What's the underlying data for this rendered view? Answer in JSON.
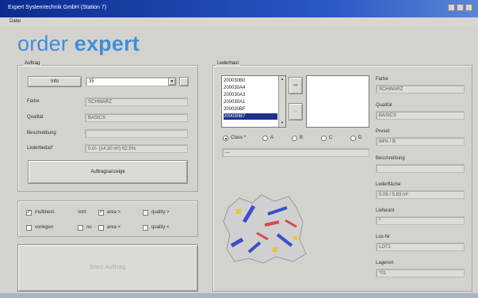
{
  "window": {
    "title": "Expert Systemtechnik GmbH (Station 7)"
  },
  "menu": {
    "items": [
      "Datei"
    ]
  },
  "brand": {
    "word1": "order",
    "word2": "expert"
  },
  "auftrag": {
    "group_label": "Auftrag",
    "info_button": "Info",
    "order_select_value": "35",
    "farbe_label": "Farbe",
    "farbe_value": "SCHWARZ",
    "qualitaet_label": "Qualität",
    "qualitaet_value": "BASICS",
    "beschreibung_label": "Beschreibung",
    "beschreibung_value": "",
    "lederbedarf_label": "Lederbedarf",
    "lederbedarf_value": "0.0/- (14.30 m²) 62.5%",
    "auftrag_button": "Auftragsanzeige"
  },
  "options": {
    "multinest": {
      "label": "multinest",
      "checked": true
    },
    "sort_label": "sort:",
    "area_gt": {
      "label": "area >",
      "checked": true
    },
    "quality_gt": {
      "label": "quality >",
      "checked": false
    },
    "vorlegen": {
      "label": "vorlegen",
      "checked": false
    },
    "no": {
      "label": "no",
      "checked": false
    },
    "area_lt": {
      "label": "area <",
      "checked": false
    },
    "quality_lt": {
      "label": "quality <",
      "checked": false
    }
  },
  "start_button": "Start Auftrag",
  "lederhaut": {
    "group_label": "Lederhaut",
    "list": [
      "200030B0",
      "200030A4",
      "200030A3",
      "200030A1",
      "200030BF",
      "200030B7"
    ],
    "selected_index": 5,
    "move_right": ">>",
    "move_left": "<<",
    "class_radios": [
      {
        "label": "Class *",
        "selected": true
      },
      {
        "label": "A",
        "selected": false
      },
      {
        "label": "B",
        "selected": false
      },
      {
        "label": "C",
        "selected": false
      },
      {
        "label": "D",
        "selected": false
      }
    ],
    "note_value": "—"
  },
  "details": {
    "farbe_label": "Farbe",
    "farbe_value": "SCHWARZ",
    "qualitaet_label": "Qualität",
    "qualitaet_value": "BASICS",
    "preset_label": "Preset",
    "preset_value": "84% / B",
    "beschreibung_label": "Beschreibung",
    "beschreibung_value": "",
    "lederflaeche_label": "Lederfläche",
    "lederflaeche_value": "5.06 / 5.83 m²",
    "lieferant_label": "Lieferant",
    "lieferant_value": "*",
    "losnr_label": "Los-Nr",
    "losnr_value": "LOT1",
    "lagerort_label": "Lagerort",
    "lagerort_value": "*01"
  },
  "colors": {
    "title_bar": "#0b2c8f",
    "brand": "#3f8fd9",
    "selection": "#1e2f8c",
    "window_bg": "#d4d2cd"
  }
}
